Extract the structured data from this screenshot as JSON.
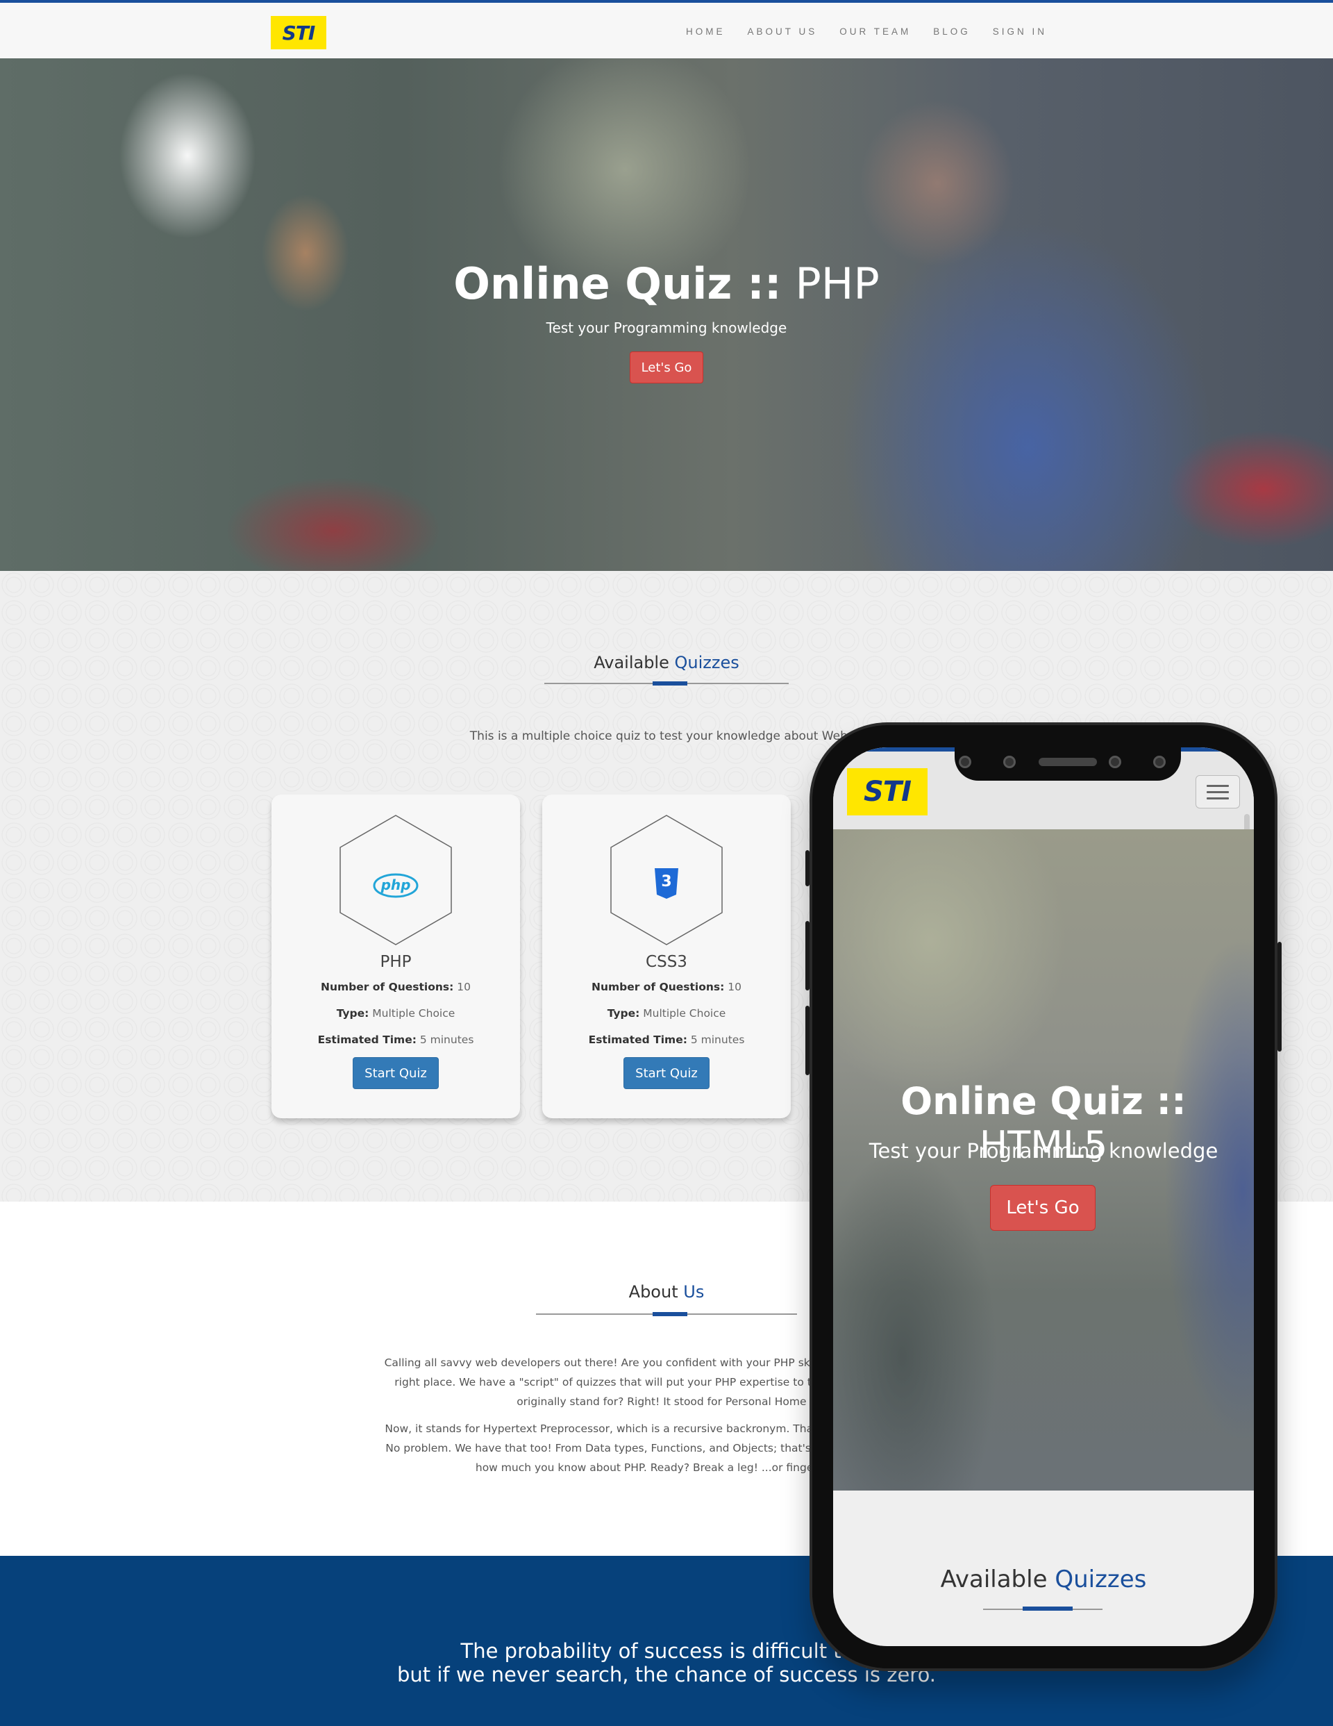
{
  "navbar": {
    "logo": "STI",
    "items": [
      {
        "label": "HOME"
      },
      {
        "label": "ABOUT US"
      },
      {
        "label": "OUR TEAM"
      },
      {
        "label": "BLOG"
      },
      {
        "label": "SIGN IN"
      }
    ]
  },
  "hero": {
    "title_bold": "Online Quiz ::",
    "title_light": "PHP",
    "subtitle": "Test your Programming knowledge",
    "button": "Let's Go"
  },
  "quizzes": {
    "title_plain": "Available",
    "title_accent": "Quizzes",
    "intro": "This is a multiple choice quiz to test your knowledge about Web Pr",
    "cards": [
      {
        "name": "PHP",
        "icon": "php-icon",
        "icon_label": "php",
        "questions_label": "Number of Questions:",
        "questions": "10",
        "type_label": "Type:",
        "type": "Multiple Choice",
        "time_label": "Estimated Time:",
        "time": "5 minutes",
        "button": "Start Quiz"
      },
      {
        "name": "CSS3",
        "icon": "css3-icon",
        "icon_label": "3",
        "questions_label": "Number of Questions:",
        "questions": "10",
        "type_label": "Type:",
        "type": "Multiple Choice",
        "time_label": "Estimated Time:",
        "time": "5 minutes",
        "button": "Start Quiz"
      }
    ]
  },
  "about": {
    "title_plain": "About",
    "title_accent": "Us",
    "p1": [
      "Calling all savvy web developers out there! Are you confident with your PHP skills? If you want to find ou",
      "right place. We have a \"script\" of quizzes that will put your PHP expertise to the test. Are you ready f",
      "originally stand for? Right! It stood for Personal Home P"
    ],
    "p2": [
      "Now, it stands for Hypertext Preprocessor, which is a recursive backronym. That's another trivia for you!",
      "No problem. We have that too! From Data types, Functions, and Objects; that's quite a loop of questions",
      "how much you know about PHP. Ready? Break a leg! ...or finger, in you"
    ]
  },
  "quote": {
    "line1": "The probability of success is difficult to e",
    "line2": "but if we never search, the chance of success is zero."
  },
  "phone": {
    "logo": "STI",
    "hero_title_bold": "Online Quiz ::",
    "hero_title_light": "HTML5",
    "hero_subtitle": "Test your Programming knowledge",
    "hero_button": "Let's Go",
    "section_title_plain": "Available",
    "section_title_accent": "Quizzes"
  },
  "colors": {
    "brand_blue": "#1a4f9c",
    "logo_yellow": "#ffe600",
    "cta_red": "#d9534f",
    "button_blue": "#337ab7",
    "quote_bg": "#06417b"
  }
}
